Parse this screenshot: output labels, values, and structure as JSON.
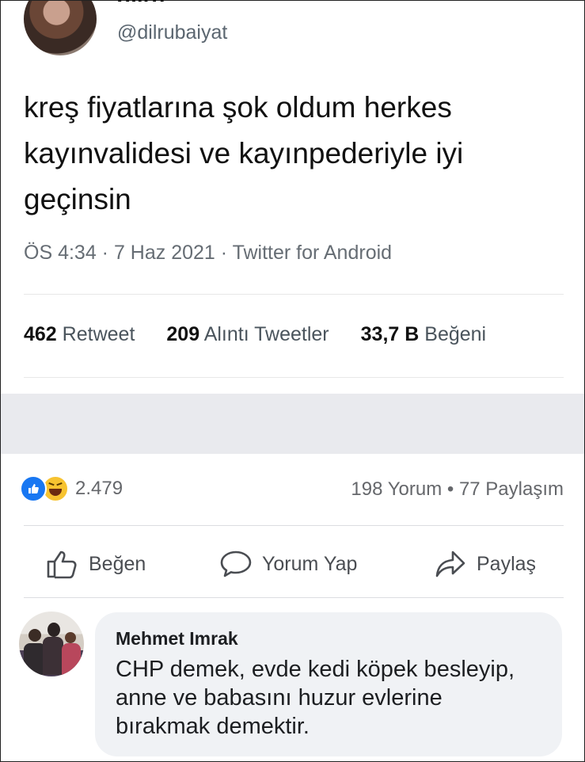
{
  "tweet": {
    "display_name": "dilru",
    "handle": "@dilrubaiyat",
    "text": "kreş fiyatlarına şok oldum herkes kayınvalidesi ve kayınpederiyle iyi geçinsin",
    "meta": "ÖS 4:34 · 7 Haz 2021 · Twitter for Android",
    "stats": [
      {
        "count": "462",
        "label": "Retweet"
      },
      {
        "count": "209",
        "label": "Alıntı Tweetler"
      },
      {
        "count": "33,7 B",
        "label": "Beğeni"
      }
    ]
  },
  "post": {
    "reaction_count": "2.479",
    "reaction_icons": [
      "like-icon",
      "haha-icon"
    ],
    "comments_label": "198 Yorum",
    "shares_label": "77 Paylaşım",
    "separator": "•",
    "actions": {
      "like": "Beğen",
      "comment": "Yorum Yap",
      "share": "Paylaş"
    }
  },
  "comment": {
    "author": "Mehmet Imrak",
    "text": "CHP demek, evde kedi köpek besleyip, anne ve babasını huzur evlerine bırakmak demektir."
  },
  "colors": {
    "facebook_blue": "#1877f2",
    "haha_yellow": "#f7c330",
    "band_gray": "#e9eaee",
    "bubble_gray": "#f0f2f5"
  }
}
